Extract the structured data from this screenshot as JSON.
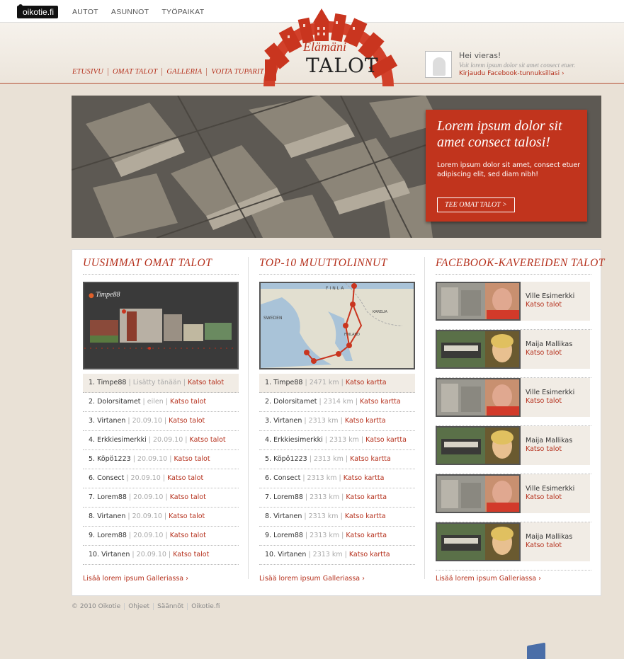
{
  "topbar": {
    "logo": "oikotie.fi",
    "nav": [
      "AUTOT",
      "ASUNNOT",
      "TYÖPAIKAT"
    ]
  },
  "header": {
    "nav": [
      "ETUSIVU",
      "OMAT TALOT",
      "GALLERIA",
      "VOITA TUPARIT"
    ],
    "brand_script": "Elämäni",
    "brand_main": "TALOT"
  },
  "user": {
    "greeting": "Hei vieras!",
    "subtitle": "Voit lorem ipsum dolor sit amet consect etuer.",
    "login": "Kirjaudu Facebook-tunnuksillasi ›"
  },
  "hero": {
    "title": "Lorem ipsum dolor sit amet consect talosi!",
    "text": "Lorem ipsum dolor sit amet, consect etuer adipiscing elit, sed diam nibh!",
    "button": "TEE OMAT TALOT >"
  },
  "col1": {
    "title": "UUSIMMAT OMAT TALOT",
    "thumb_user": "Timpe88",
    "rows": [
      {
        "name": "1. Timpe88",
        "meta": "Lisätty tänään",
        "link": "Katso talot"
      },
      {
        "name": "2. Dolorsitamet",
        "meta": "eilen",
        "link": "Katso talot"
      },
      {
        "name": "3. Virtanen",
        "meta": "20.09.10",
        "link": "Katso talot"
      },
      {
        "name": "4. Erkkiesimerkki",
        "meta": "20.09.10",
        "link": "Katso talot"
      },
      {
        "name": "5. Köpö1223",
        "meta": "20.09.10",
        "link": "Katso talot"
      },
      {
        "name": "6. Consect",
        "meta": "20.09.10",
        "link": "Katso talot"
      },
      {
        "name": "7. Lorem88",
        "meta": "20.09.10",
        "link": "Katso talot"
      },
      {
        "name": "8. Virtanen",
        "meta": "20.09.10",
        "link": "Katso talot"
      },
      {
        "name": "9. Lorem88",
        "meta": "20.09.10",
        "link": "Katso talot"
      },
      {
        "name": "10. Virtanen",
        "meta": "20.09.10",
        "link": "Katso talot"
      }
    ],
    "more": "Lisää lorem ipsum Galleriassa ›"
  },
  "col2": {
    "title": "TOP-10 MUUTTOLINNUT",
    "map_labels": [
      "FINLA",
      "SWEDEN",
      "FINLAND",
      "KARELIA"
    ],
    "rows": [
      {
        "name": "1. Timpe88",
        "meta": "2471 km",
        "link": "Katso kartta"
      },
      {
        "name": "2. Dolorsitamet",
        "meta": "2314 km",
        "link": "Katso kartta"
      },
      {
        "name": "3. Virtanen",
        "meta": "2313 km",
        "link": "Katso kartta"
      },
      {
        "name": "4. Erkkiesimerkki",
        "meta": "2313 km",
        "link": "Katso kartta"
      },
      {
        "name": "5. Köpö1223",
        "meta": "2313 km",
        "link": "Katso kartta"
      },
      {
        "name": "6. Consect",
        "meta": "2313 km",
        "link": "Katso kartta"
      },
      {
        "name": "7. Lorem88",
        "meta": "2313 km",
        "link": "Katso kartta"
      },
      {
        "name": "8. Virtanen",
        "meta": "2313 km",
        "link": "Katso kartta"
      },
      {
        "name": "9. Lorem88",
        "meta": "2313 km",
        "link": "Katso kartta"
      },
      {
        "name": "10. Virtanen",
        "meta": "2313 km",
        "link": "Katso kartta"
      }
    ],
    "more": "Lisää lorem ipsum Galleriassa ›"
  },
  "col3": {
    "title": "FACEBOOK-KAVEREIDEN TALOT",
    "friends": [
      {
        "name": "Ville Esimerkki",
        "link": "Katso talot"
      },
      {
        "name": "Maija Mallikas",
        "link": "Katso talot"
      },
      {
        "name": "Ville Esimerkki",
        "link": "Katso talot"
      },
      {
        "name": "Maija Mallikas",
        "link": "Katso talot"
      },
      {
        "name": "Ville Esimerkki",
        "link": "Katso talot"
      },
      {
        "name": "Maija Mallikas",
        "link": "Katso talot"
      }
    ],
    "more": "Lisää lorem ipsum Galleriassa ›"
  },
  "footer": [
    "© 2010 Oikotie",
    "Ohjeet",
    "Säännöt",
    "Oikotie.fi"
  ],
  "colors": {
    "accent": "#b5301c",
    "background": "#e9e1d6"
  }
}
